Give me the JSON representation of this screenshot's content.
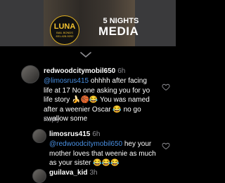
{
  "banner": {
    "luna": {
      "title": "LUNA",
      "line1": "BAIL BONDS",
      "line2": "831-428-9292"
    },
    "nights": {
      "line1": "5 NIGHTS",
      "line2": "MEDIA"
    }
  },
  "comments": [
    {
      "username": "redwoodcitymobil650",
      "time": "6h",
      "mention": "@limosrus415",
      "text": " ohhhh after facing life at 17  No one asking you for yo life story 🍌🏀😂 You was named after a weenier Oscar 😂  no go swallow some",
      "reply": "Reply"
    },
    {
      "username": "limosrus415",
      "time": "6h",
      "mention": "@redwoodcitymobil650",
      "text": " hey your mother loves that weenie as much as your sister 😂😂😂",
      "reply": "Reply"
    },
    {
      "username": "guilava_kid",
      "time": "3h"
    }
  ],
  "colors": {
    "mention": "#4a90e2",
    "secondary": "#8e8e93",
    "background": "#000000"
  }
}
